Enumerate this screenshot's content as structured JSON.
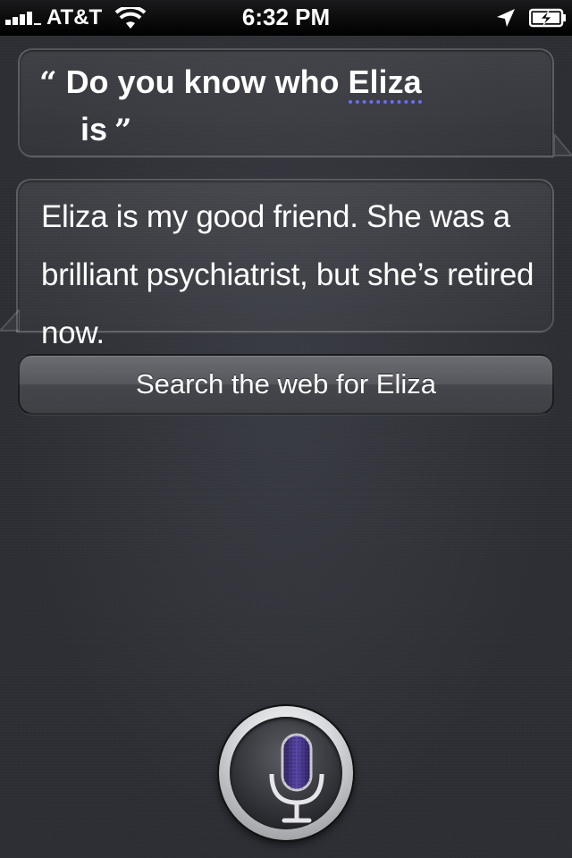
{
  "status_bar": {
    "carrier": "AT&T",
    "time": "6:32 PM",
    "icons": [
      "signal-bars-icon",
      "wifi-icon",
      "location-arrow-icon",
      "battery-charging-icon"
    ]
  },
  "conversation": {
    "user_query": {
      "open_quote": "“",
      "text_before": "Do you know who ",
      "highlighted_word": "Eliza",
      "text_after": " is",
      "close_quote": "”"
    },
    "siri_response": "Eliza is my good friend. She was a brilliant psychiatrist, but she’s retired now.",
    "search_button_label": "Search the web for Eliza"
  },
  "mic": {
    "icon": "microphone-icon"
  },
  "colors": {
    "highlight_underline": "#6a6cf5",
    "mic_fill": "#4a3a8c"
  }
}
